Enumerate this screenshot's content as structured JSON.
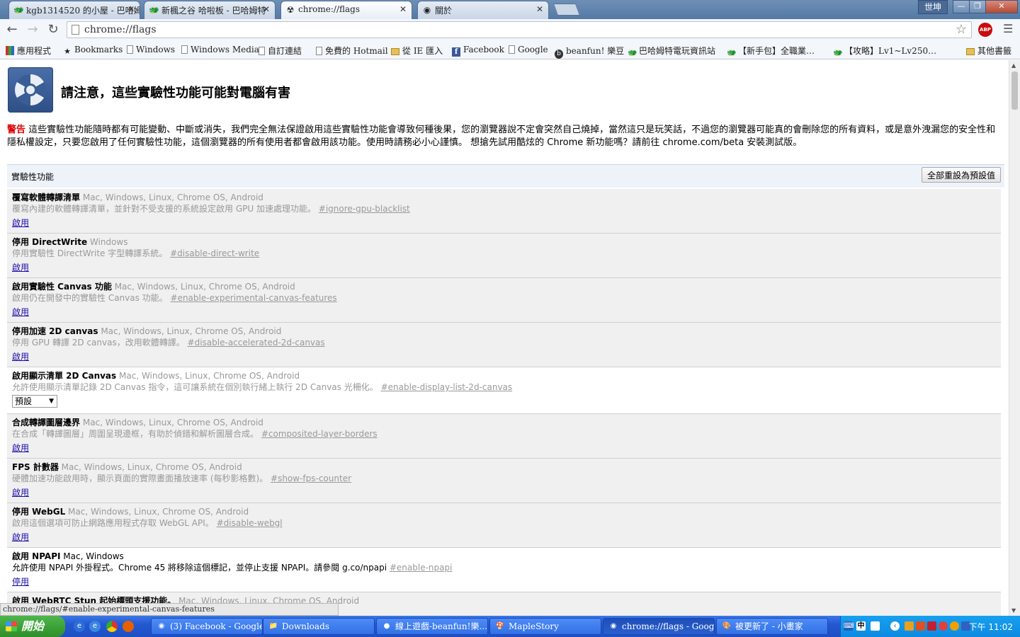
{
  "tabs": [
    {
      "title": "kgb1314520 的小屋 - 巴哈姆",
      "icon": "bahamut-icon"
    },
    {
      "title": "新楓之谷 哈啦板 - 巴哈姆特",
      "icon": "bahamut-icon"
    },
    {
      "title": "chrome://flags",
      "icon": "radiation-icon"
    },
    {
      "title": "關於",
      "icon": "chrome-icon"
    }
  ],
  "window": {
    "user": "世坤",
    "min": "—",
    "max": "❐",
    "close": "✕"
  },
  "toolbar": {
    "url": "chrome://flags",
    "abp": "ABP"
  },
  "bookmarks": [
    {
      "label": "應用程式",
      "icon": "apps"
    },
    {
      "label": "Bookmarks",
      "icon": "star"
    },
    {
      "label": "Windows",
      "icon": "page"
    },
    {
      "label": "Windows Media",
      "icon": "page"
    },
    {
      "label": "自訂連結",
      "icon": "page"
    },
    {
      "label": "免費的 Hotmail",
      "icon": "page"
    },
    {
      "label": "從 IE 匯入",
      "icon": "folder"
    },
    {
      "label": "Facebook",
      "icon": "fb"
    },
    {
      "label": "Google",
      "icon": "page"
    },
    {
      "label": "beanfun! 樂豆",
      "icon": "round"
    },
    {
      "label": "巴哈姆特電玩資訊站",
      "icon": "bahamut"
    },
    {
      "label": "【新手包】全職業…",
      "icon": "bahamut"
    },
    {
      "label": "【攻略】Lv1~Lv250…",
      "icon": "bahamut"
    },
    {
      "label": "其他書籤",
      "icon": "folder"
    }
  ],
  "page": {
    "heading": "請注意，這些實驗性功能可能對電腦有害",
    "warning_label": "警告",
    "warning_text": " 這些實驗性功能隨時都有可能變動、中斷或消失，我們完全無法保證啟用這些實驗性功能會導致何種後果，您的瀏覽器說不定會突然自己燒掉，當然這只是玩笑話，不過您的瀏覽器可能真的會刪除您的所有資料，或是意外洩漏您的安全性和隱私權設定，只要您啟用了任何實驗性功能，這個瀏覽器的所有使用者都會啟用該功能。使用時請務必小心謹慎。 想搶先試用酷炫的 Chrome 新功能嗎？請前往 chrome.com/beta 安裝測試版。",
    "section_title": "實驗性功能",
    "reset_button": "全部重設為預設值"
  },
  "experiments": [
    {
      "name": "覆寫軟體轉譯清單",
      "platforms": "Mac, Windows, Linux, Chrome OS, Android",
      "desc": "覆寫內建的軟體轉譯清單，並針對不受支援的系統設定啟用 GPU 加速處理功能。",
      "flag": "#ignore-gpu-blacklist",
      "action": "啟用",
      "state": "disabled"
    },
    {
      "name": "停用 DirectWrite",
      "platforms": "Windows",
      "desc": "停用實驗性 DirectWrite 字型轉譯系統。",
      "flag": "#disable-direct-write",
      "action": "啟用",
      "state": "disabled"
    },
    {
      "name": "啟用實驗性 Canvas 功能",
      "platforms": "Mac, Windows, Linux, Chrome OS, Android",
      "desc": "啟用仍在開發中的實驗性 Canvas 功能。",
      "flag": "#enable-experimental-canvas-features",
      "action": "啟用",
      "state": "disabled"
    },
    {
      "name": "停用加速 2D canvas",
      "platforms": "Mac, Windows, Linux, Chrome OS, Android",
      "desc": "停用 GPU 轉譯 2D canvas，改用軟體轉譯。",
      "flag": "#disable-accelerated-2d-canvas",
      "action": "啟用",
      "state": "disabled"
    },
    {
      "name": "啟用顯示清單 2D Canvas",
      "platforms": "Mac, Windows, Linux, Chrome OS, Android",
      "desc": "允許使用顯示清單記錄 2D Canvas 指令，這可讓系統在個別執行緒上執行 2D Canvas 光柵化。",
      "flag": "#enable-display-list-2d-canvas",
      "action": "預設",
      "state": "select"
    },
    {
      "name": "合成轉譯圖層邊界",
      "platforms": "Mac, Windows, Linux, Chrome OS, Android",
      "desc": "在合成「轉譯圖層」周圍呈現邊框，有助於偵錯和解析圖層合成。",
      "flag": "#composited-layer-borders",
      "action": "啟用",
      "state": "disabled"
    },
    {
      "name": "FPS 計數器",
      "platforms": "Mac, Windows, Linux, Chrome OS, Android",
      "desc": "硬體加速功能啟用時，顯示頁面的實際畫面播放速率 (每秒影格數)。",
      "flag": "#show-fps-counter",
      "action": "啟用",
      "state": "disabled"
    },
    {
      "name": "停用 WebGL",
      "platforms": "Mac, Windows, Linux, Chrome OS, Android",
      "desc": "啟用這個選項可防止網路應用程式存取 WebGL API。",
      "flag": "#disable-webgl",
      "action": "啟用",
      "state": "disabled"
    },
    {
      "name": "啟用 NPAPI",
      "platforms": "Mac, Windows",
      "desc": "允許使用 NPAPI 外掛程式。Chrome 45 將移除這個標記，並停止支援 NPAPI。請參閱 g.co/npapi",
      "flag": "#enable-npapi",
      "action": "停用",
      "state": "enabled"
    },
    {
      "name": "啟用 WebRTC Stun 起始標頭支援功能。",
      "platforms": "Mac, Windows, Linux, Chrome OS, Android",
      "desc": "",
      "flag": "",
      "action": "",
      "state": "disabled"
    }
  ],
  "status_url": "chrome://flags/#enable-experimental-canvas-features",
  "taskbar": {
    "start": "開始",
    "items": [
      {
        "label": "(3) Facebook - Google...",
        "icon": "chrome-icon"
      },
      {
        "label": "Downloads",
        "icon": "folder-icon"
      },
      {
        "label": "線上遊戲-beanfun!樂...",
        "icon": "firefox-icon"
      },
      {
        "label": "MapleStory",
        "icon": "maple-icon"
      },
      {
        "label": "chrome://flags - Googl...",
        "icon": "chrome-icon"
      },
      {
        "label": "被更新了 - 小畫家",
        "icon": "paint-icon"
      }
    ],
    "ime": "中",
    "clock": "下午 11:02"
  },
  "colors": {
    "warning_red": "#dd0000",
    "link_blue": "#1a0dab",
    "taskbar_blue": "#2458d0",
    "start_green": "#2d8f2a"
  }
}
